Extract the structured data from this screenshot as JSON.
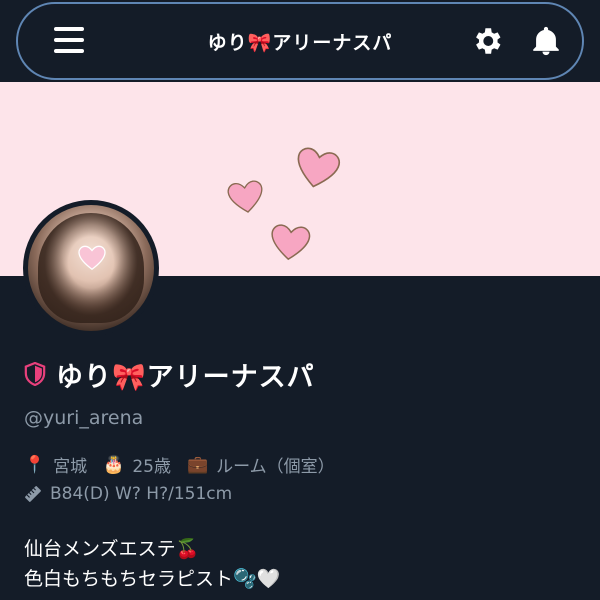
{
  "header": {
    "title": "ゆり🎀アリーナスパ",
    "menu_icon": "hamburger-menu-icon",
    "settings_icon": "gear-icon",
    "notifications_icon": "bell-icon"
  },
  "banner": {
    "background": "#fde4ea",
    "decoration": "pink-hearts"
  },
  "profile": {
    "name": "ゆり🎀アリーナスパ",
    "badge_icon": "shield-icon",
    "badge_color": "#e8407c",
    "handle": "@yuri_arena",
    "info": {
      "location_icon": "pin",
      "location_emoji": "📍",
      "location": "宮城",
      "age_icon": "cake",
      "age_emoji": "🎂",
      "age": "25歳",
      "work_icon": "briefcase",
      "work_emoji": "💼",
      "work": "ルーム（個室）",
      "measurements_icon": "ruler-icon",
      "measurements": "B84(D) W? H?/151cm"
    },
    "bio": [
      "仙台メンズエステ🍒",
      "色白もちもちセラピスト🫧🤍"
    ]
  },
  "colors": {
    "background": "#141c28",
    "accent_border": "#5f86b4",
    "muted_text": "#8d9aa8"
  }
}
